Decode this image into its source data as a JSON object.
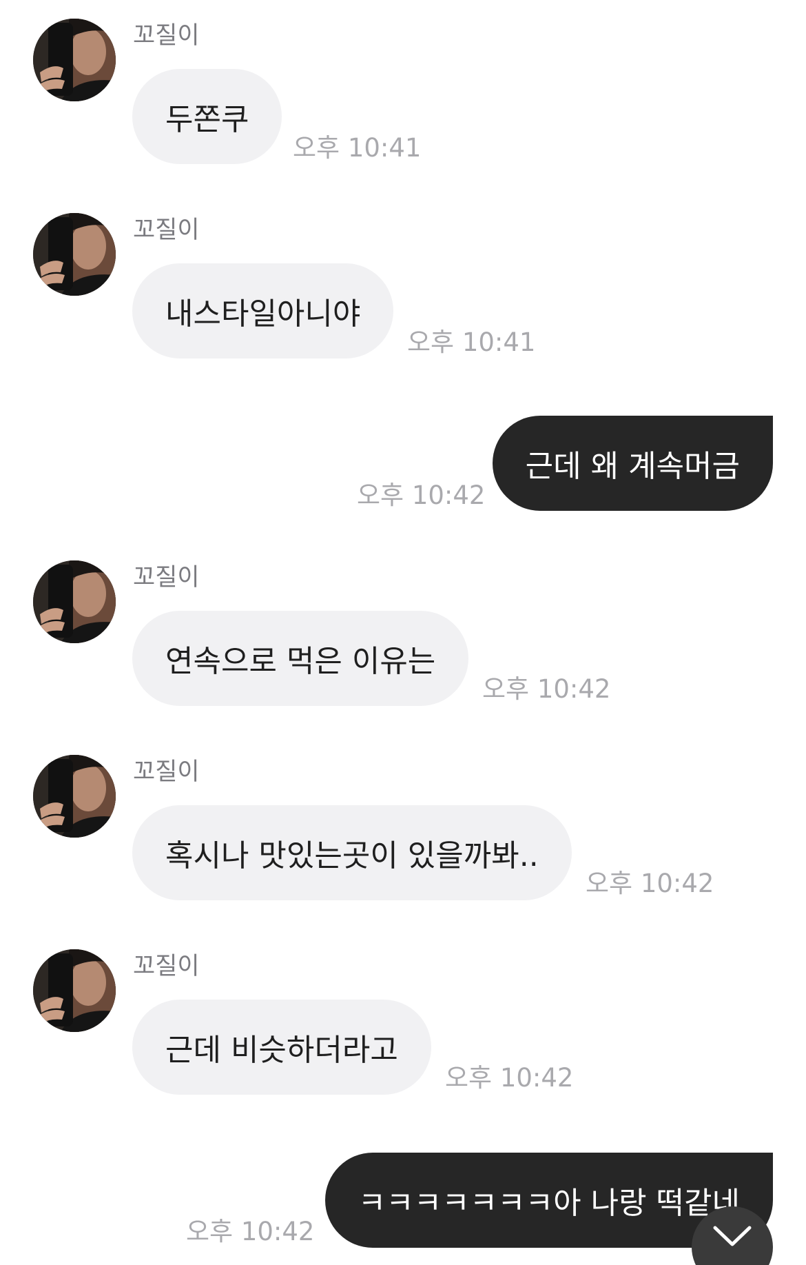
{
  "contact": {
    "name": "꼬질이"
  },
  "messages": [
    {
      "from": "contact",
      "sender": "꼬질이",
      "text": "두쫀쿠",
      "time": "오후 10:41"
    },
    {
      "from": "contact",
      "sender": "꼬질이",
      "text": "내스타일아니야",
      "time": "오후 10:41"
    },
    {
      "from": "me",
      "text": "근데 왜 계속머금",
      "time": "오후 10:42"
    },
    {
      "from": "contact",
      "sender": "꼬질이",
      "text": "연속으로 먹은 이유는",
      "time": "오후 10:42"
    },
    {
      "from": "contact",
      "sender": "꼬질이",
      "text": "혹시나 맛있는곳이 있을까봐..",
      "time": "오후 10:42"
    },
    {
      "from": "contact",
      "sender": "꼬질이",
      "text": "근데 비슷하더라고",
      "time": "오후 10:42"
    },
    {
      "from": "me",
      "text": "ㅋㅋㅋㅋㅋㅋㅋ아 나랑 떡같네",
      "time": "오후 10:42"
    }
  ],
  "icons": {
    "avatar": "profile-photo",
    "scroll_down": "chevron-down-icon"
  },
  "colors": {
    "incoming_bubble": "#f1f1f3",
    "outgoing_bubble": "#262626",
    "timestamp": "#a9a9ad",
    "sender_name": "#7b7b80"
  }
}
